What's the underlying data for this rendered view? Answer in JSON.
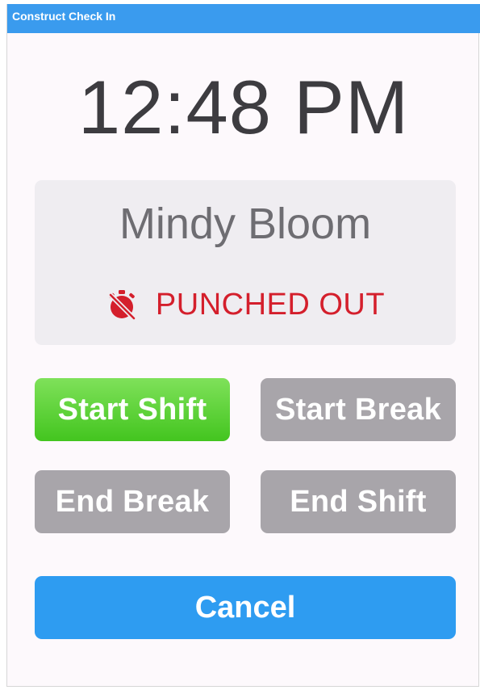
{
  "window": {
    "title": "Construct Check In"
  },
  "clock": {
    "time": "12:48 PM"
  },
  "employee": {
    "name": "Mindy Bloom",
    "status": "PUNCHED OUT",
    "status_icon": "stopwatch-off-icon",
    "status_color": "#d41f2c"
  },
  "actions": {
    "start_shift": "Start Shift",
    "start_break": "Start Break",
    "end_break": "End Break",
    "end_shift": "End Shift",
    "cancel": "Cancel"
  },
  "colors": {
    "titlebar": "#3a9bee",
    "start_shift": "#56cf2d",
    "disabled": "#a8a5aa",
    "cancel": "#2e9cf1"
  }
}
